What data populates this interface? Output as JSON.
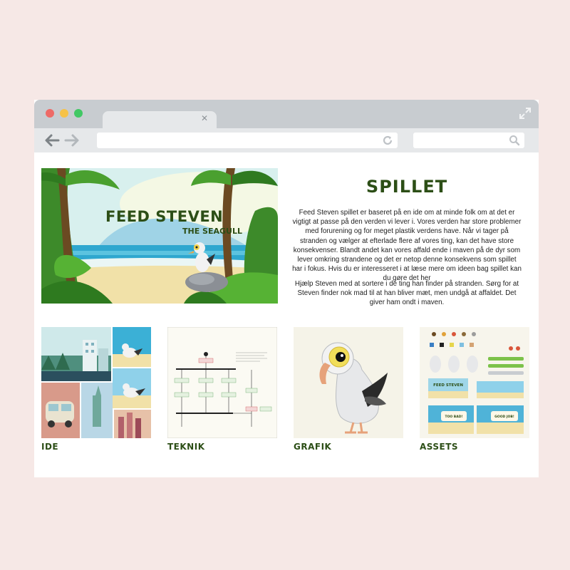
{
  "hero": {
    "title": "FEED STEVEN",
    "subtitle": "THE SEAGULL"
  },
  "section": {
    "title": "SPILLET",
    "paragraph1": "Feed Steven spillet er baseret på en ide om at minde folk om at det er vigtigt at passe på den verden vi lever i. Vores verden har store problemer med forurening og for meget plastik verdens have. Når vi tager på stranden og vælger at efterlade flere af vores ting, kan det have store konsekvenser. Blandt andet kan vores affald ende i maven på de dyr som lever omkring strandene og det er netop denne konsekvens som spillet har i fokus. Hvis du er interesseret i at læse mere om ideen bag spillet kan du gøre det her",
    "paragraph2": "Hjælp Steven med at sortere i de ting han finder på stranden. Sørg for at Steven finder nok mad til at han bliver mæt, men undgå at affaldet. Det giver ham ondt i maven."
  },
  "cards": [
    {
      "label": "IDE"
    },
    {
      "label": "TEKNIK"
    },
    {
      "label": "GRAFIK"
    },
    {
      "label": "ASSETS"
    }
  ],
  "thumb_text": {
    "assets_title": "FEED STEVEN",
    "assets_bad": "TOO BAD!",
    "assets_good": "GOOD JOB!"
  },
  "colors": {
    "accent": "#2c4e16",
    "background": "#f6e8e6",
    "chrome": "#c8ccd0"
  }
}
